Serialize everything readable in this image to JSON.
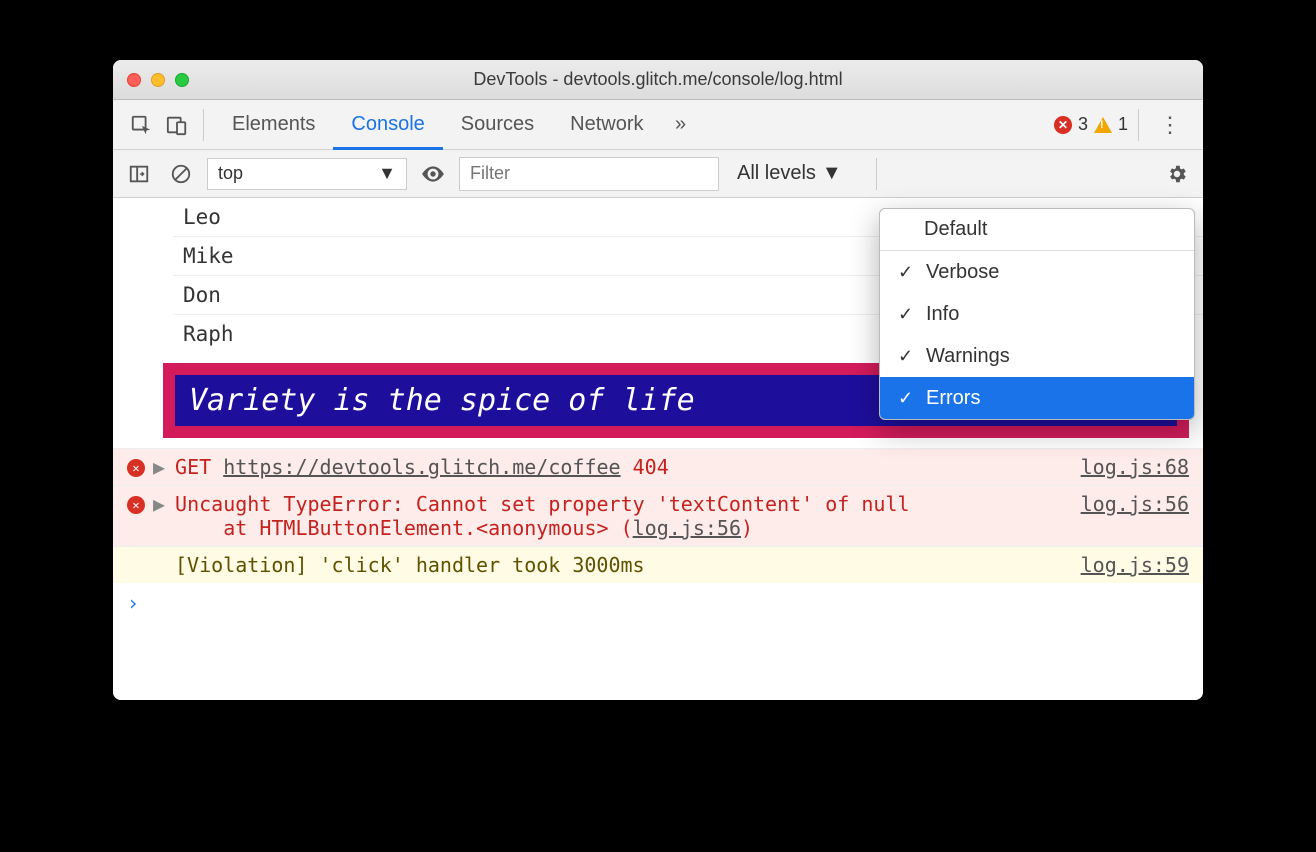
{
  "window": {
    "title": "DevTools - devtools.glitch.me/console/log.html"
  },
  "tabs": {
    "items": [
      "Elements",
      "Console",
      "Sources",
      "Network"
    ],
    "active_index": 1,
    "overflow_glyph": "»"
  },
  "badge": {
    "error_count": "3",
    "warning_count": "1"
  },
  "toolbar": {
    "context": "top",
    "filter_placeholder": "Filter",
    "levels_label": "All levels"
  },
  "dropdown": {
    "default_label": "Default",
    "items": [
      {
        "label": "Verbose",
        "checked": true,
        "selected": false
      },
      {
        "label": "Info",
        "checked": true,
        "selected": false
      },
      {
        "label": "Warnings",
        "checked": true,
        "selected": false
      },
      {
        "label": "Errors",
        "checked": true,
        "selected": true
      }
    ]
  },
  "tree": {
    "rows": [
      "Leo",
      "Mike",
      "Don",
      "Raph"
    ]
  },
  "styled_message": "Variety is the spice of life",
  "messages": [
    {
      "type": "error",
      "method": "GET",
      "url": "https://devtools.glitch.me/coffee",
      "status": "404",
      "source": "log.js:68"
    },
    {
      "type": "error",
      "text": "Uncaught TypeError: Cannot set property 'textContent' of null",
      "stack_prefix": "at HTMLButtonElement.<anonymous> (",
      "stack_link": "log.js:56",
      "stack_suffix": ")",
      "source": "log.js:56"
    },
    {
      "type": "violation",
      "text": "[Violation] 'click' handler took 3000ms",
      "source": "log.js:59"
    }
  ],
  "prompt": "›"
}
